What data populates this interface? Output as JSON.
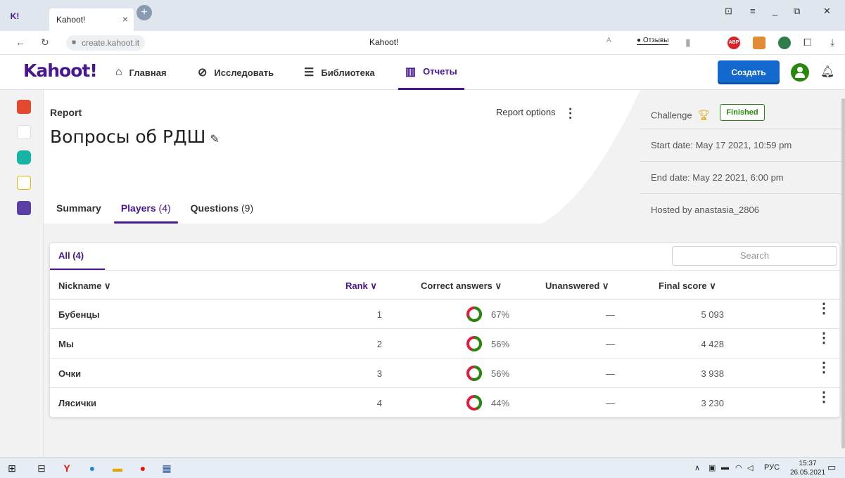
{
  "browser": {
    "tab_logo": "K!",
    "tab_title": "Kahoot!",
    "tab_close": "×",
    "new_tab": "+",
    "url": "create.kahoot.it",
    "page_title": "Kahoot!",
    "translate": "A",
    "reviews": "Отзывы",
    "ext_abp": "ABP"
  },
  "header": {
    "logo": "Kahoot!",
    "nav": [
      {
        "label": "Главная",
        "icon": "home-icon"
      },
      {
        "label": "Исследовать",
        "icon": "compass-icon"
      },
      {
        "label": "Библиотека",
        "icon": "list-icon"
      },
      {
        "label": "Отчеты",
        "icon": "chart-icon"
      }
    ],
    "create": "Создать"
  },
  "report": {
    "label": "Report",
    "title": "Вопросы об РДШ",
    "options": "Report options",
    "tabs": [
      {
        "label": "Summary",
        "count": ""
      },
      {
        "label": "Players",
        "count": "(4)"
      },
      {
        "label": "Questions",
        "count": "(9)"
      }
    ]
  },
  "info": {
    "challenge": "Challenge",
    "status": "Finished",
    "start": "Start date: May 17 2021, 10:59 pm",
    "end": "End date: May 22 2021, 6:00 pm",
    "host": "Hosted by anastasia_2806"
  },
  "table": {
    "filter": "All (4)",
    "search_placeholder": "Search",
    "headers": {
      "nickname": "Nickname ∨",
      "rank": "Rank ∨",
      "correct": "Correct answers ∨",
      "unanswered": "Unanswered ∨",
      "score": "Final score ∨"
    },
    "rows": [
      {
        "nickname": "Бубенцы",
        "rank": "1",
        "correct_pct": 67,
        "correct": "67%",
        "unanswered": "—",
        "score": "5 093"
      },
      {
        "nickname": "Мы",
        "rank": "2",
        "correct_pct": 56,
        "correct": "56%",
        "unanswered": "—",
        "score": "4 428"
      },
      {
        "nickname": "Очки",
        "rank": "3",
        "correct_pct": 56,
        "correct": "56%",
        "unanswered": "—",
        "score": "3 938"
      },
      {
        "nickname": "Лясички",
        "rank": "4",
        "correct_pct": 44,
        "correct": "44%",
        "unanswered": "—",
        "score": "3 230"
      }
    ]
  },
  "taskbar": {
    "lang": "РУС",
    "time": "15:37",
    "date": "26.05.2021"
  },
  "colors": {
    "brand": "#46178f",
    "create": "#1368ce",
    "correct": "#26890c",
    "incorrect": "#e21b3c"
  }
}
